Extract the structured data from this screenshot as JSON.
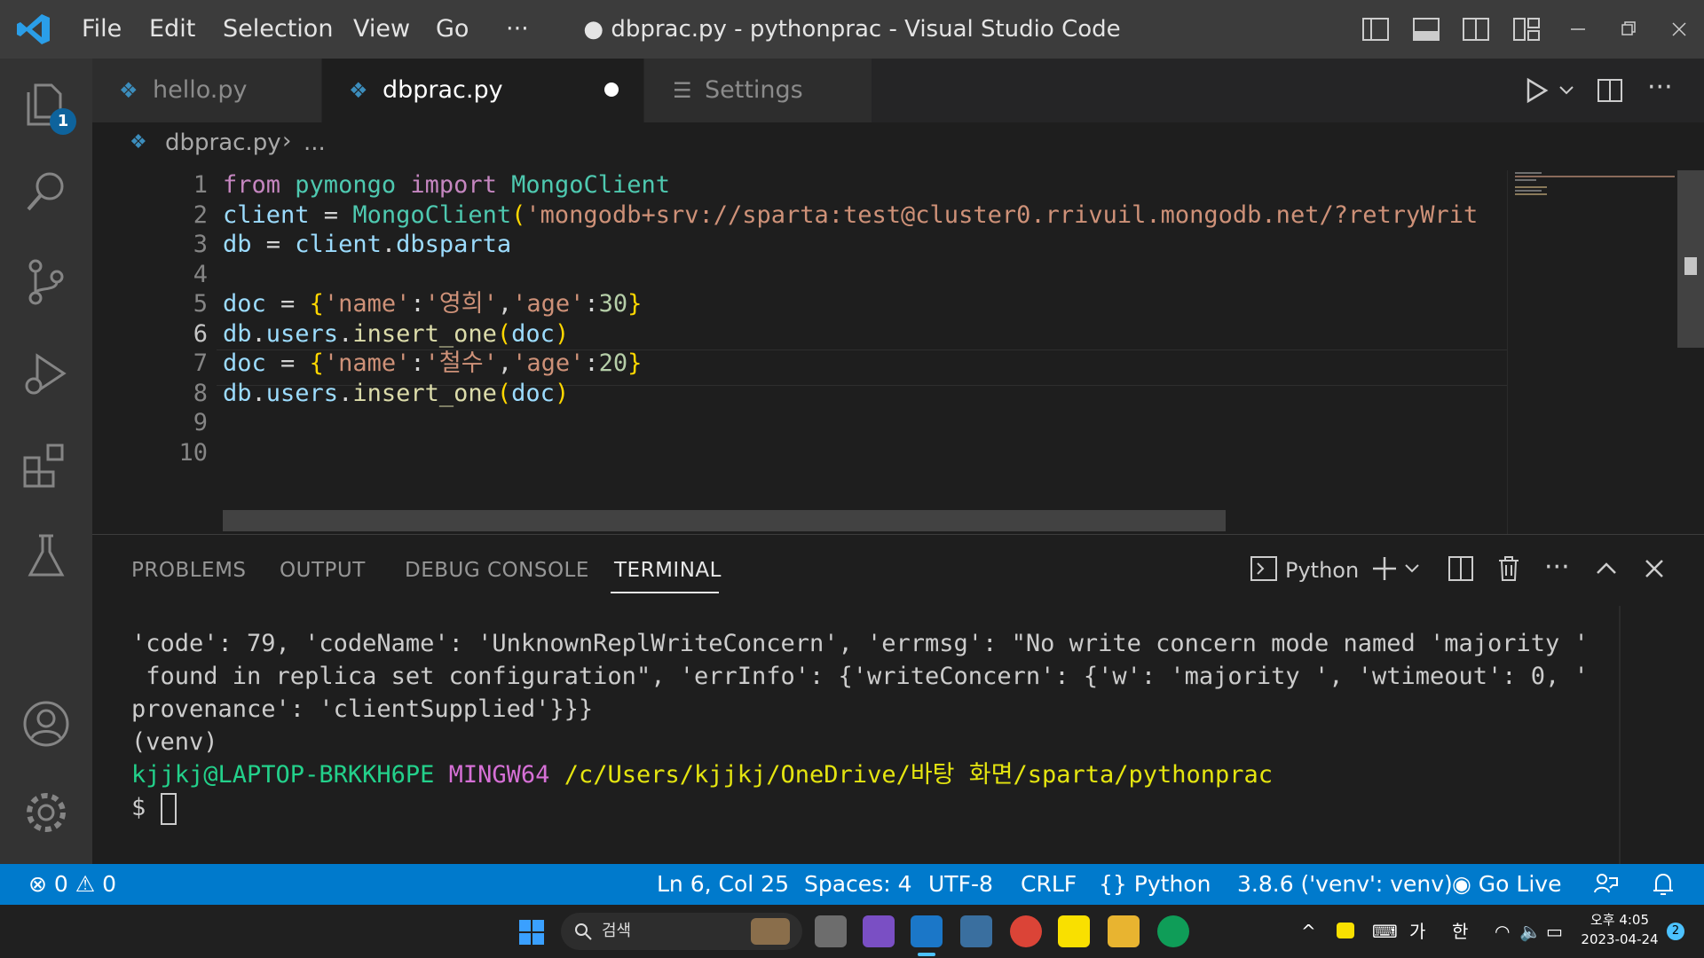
{
  "titlebar": {
    "menu": [
      "File",
      "Edit",
      "Selection",
      "View",
      "Go",
      "···"
    ],
    "title": "● dbprac.py - pythonprac - Visual Studio Code"
  },
  "activity": {
    "explorer_badge": "1"
  },
  "tabs": [
    {
      "label": "hello.py",
      "active": false
    },
    {
      "label": "dbprac.py",
      "active": true,
      "dirty": true
    },
    {
      "label": "Settings",
      "active": false
    }
  ],
  "breadcrumb": {
    "file": "dbprac.py",
    "rest": "..."
  },
  "editor": {
    "line_numbers": [
      "1",
      "2",
      "3",
      "4",
      "5",
      "6",
      "7",
      "8",
      "9",
      "10"
    ],
    "lines": [
      [
        {
          "t": "from",
          "c": "kw"
        },
        {
          "t": " ",
          "c": "op"
        },
        {
          "t": "pymongo",
          "c": "mod"
        },
        {
          "t": " ",
          "c": "op"
        },
        {
          "t": "import",
          "c": "kw"
        },
        {
          "t": " ",
          "c": "op"
        },
        {
          "t": "MongoClient",
          "c": "mod"
        }
      ],
      [
        {
          "t": "client",
          "c": "var"
        },
        {
          "t": " = ",
          "c": "op"
        },
        {
          "t": "MongoClient",
          "c": "mod"
        },
        {
          "t": "(",
          "c": "brace"
        },
        {
          "t": "'mongodb+srv://sparta:test@cluster0.rrivuil.mongodb.net/?retryWrit",
          "c": "str"
        }
      ],
      [
        {
          "t": "db",
          "c": "var"
        },
        {
          "t": " = ",
          "c": "op"
        },
        {
          "t": "client",
          "c": "var"
        },
        {
          "t": ".",
          "c": "op"
        },
        {
          "t": "dbsparta",
          "c": "var"
        }
      ],
      [],
      [
        {
          "t": "doc",
          "c": "var"
        },
        {
          "t": " = ",
          "c": "op"
        },
        {
          "t": "{",
          "c": "brace"
        },
        {
          "t": "'name'",
          "c": "str"
        },
        {
          "t": ":",
          "c": "op"
        },
        {
          "t": "'영희'",
          "c": "str"
        },
        {
          "t": ",",
          "c": "op"
        },
        {
          "t": "'age'",
          "c": "str"
        },
        {
          "t": ":",
          "c": "op"
        },
        {
          "t": "30",
          "c": "num"
        },
        {
          "t": "}",
          "c": "brace"
        }
      ],
      [
        {
          "t": "db",
          "c": "var"
        },
        {
          "t": ".",
          "c": "op"
        },
        {
          "t": "users",
          "c": "var"
        },
        {
          "t": ".",
          "c": "op"
        },
        {
          "t": "insert_one",
          "c": "fn"
        },
        {
          "t": "(",
          "c": "brace"
        },
        {
          "t": "doc",
          "c": "var"
        },
        {
          "t": ")",
          "c": "brace"
        }
      ],
      [
        {
          "t": "doc",
          "c": "var"
        },
        {
          "t": " = ",
          "c": "op"
        },
        {
          "t": "{",
          "c": "brace"
        },
        {
          "t": "'name'",
          "c": "str"
        },
        {
          "t": ":",
          "c": "op"
        },
        {
          "t": "'철수'",
          "c": "str"
        },
        {
          "t": ",",
          "c": "op"
        },
        {
          "t": "'age'",
          "c": "str"
        },
        {
          "t": ":",
          "c": "op"
        },
        {
          "t": "20",
          "c": "num"
        },
        {
          "t": "}",
          "c": "brace"
        }
      ],
      [
        {
          "t": "db",
          "c": "var"
        },
        {
          "t": ".",
          "c": "op"
        },
        {
          "t": "users",
          "c": "var"
        },
        {
          "t": ".",
          "c": "op"
        },
        {
          "t": "insert_one",
          "c": "fn"
        },
        {
          "t": "(",
          "c": "brace"
        },
        {
          "t": "doc",
          "c": "var"
        },
        {
          "t": ")",
          "c": "brace"
        }
      ],
      [],
      []
    ]
  },
  "panel": {
    "tabs": [
      "PROBLEMS",
      "OUTPUT",
      "DEBUG CONSOLE",
      "TERMINAL"
    ],
    "active_tab": "TERMINAL",
    "terminal_profile": "Python",
    "terminal_lines": [
      "'code': 79, 'codeName': 'UnknownReplWriteConcern', 'errmsg': \"No write concern mode named 'majority '",
      " found in replica set configuration\", 'errInfo': {'writeConcern': {'w': 'majority ', 'wtimeout': 0, '",
      "provenance': 'clientSupplied'}}}",
      "(venv)"
    ],
    "prompt": {
      "user": "kjjkj@LAPTOP-BRKKH6PE",
      "env": "MINGW64",
      "path": "/c/Users/kjjkj/OneDrive/바탕 화면/sparta/pythonprac"
    },
    "input_prompt": "$ "
  },
  "statusbar": {
    "errors": "0",
    "warnings": "0",
    "position": "Ln 6, Col 25",
    "spaces": "Spaces: 4",
    "encoding": "UTF-8",
    "eol": "CRLF",
    "language": "Python",
    "interpreter": "3.8.6 ('venv': venv)",
    "golive": "Go Live"
  },
  "taskbar": {
    "search_placeholder": "검색",
    "ime_ga": "가",
    "ime_han": "한",
    "time": "오후 4:05",
    "date": "2023-04-24",
    "notif_count": "2"
  },
  "colors": {
    "accent": "#007acc",
    "titlebar": "#3c3c3c",
    "editor_bg": "#1e1e1e",
    "activity_bg": "#333333"
  }
}
